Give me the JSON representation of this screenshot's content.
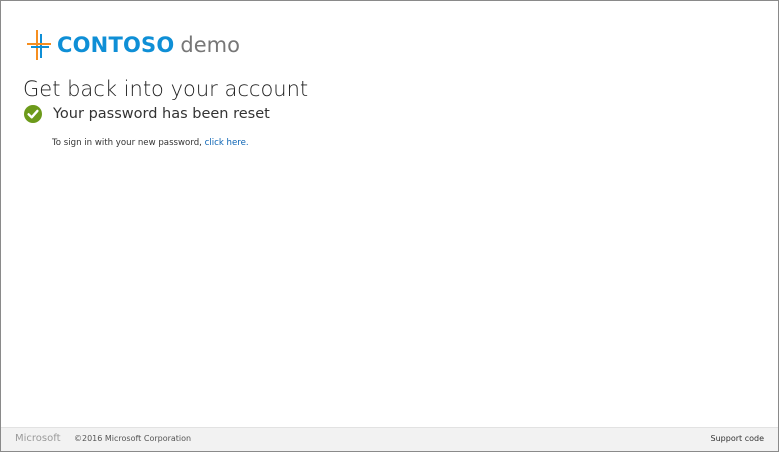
{
  "brand": {
    "name": "CONTOSO",
    "suffix": "demo",
    "colors": {
      "name": "#0f8fd6",
      "suffix": "#777777",
      "mark_orange": "#f68e1f",
      "mark_blue": "#0f8fd6"
    }
  },
  "page": {
    "title": "Get back into your account",
    "status": {
      "icon": "check-circle-icon",
      "color": "#6c9a1a",
      "text": "Your password has been reset"
    },
    "hint": {
      "text": "To sign in with your new password,",
      "link": "click here."
    }
  },
  "footer": {
    "microsoft": "Microsoft",
    "copyright": "©2016 Microsoft Corporation",
    "support": "Support code"
  }
}
